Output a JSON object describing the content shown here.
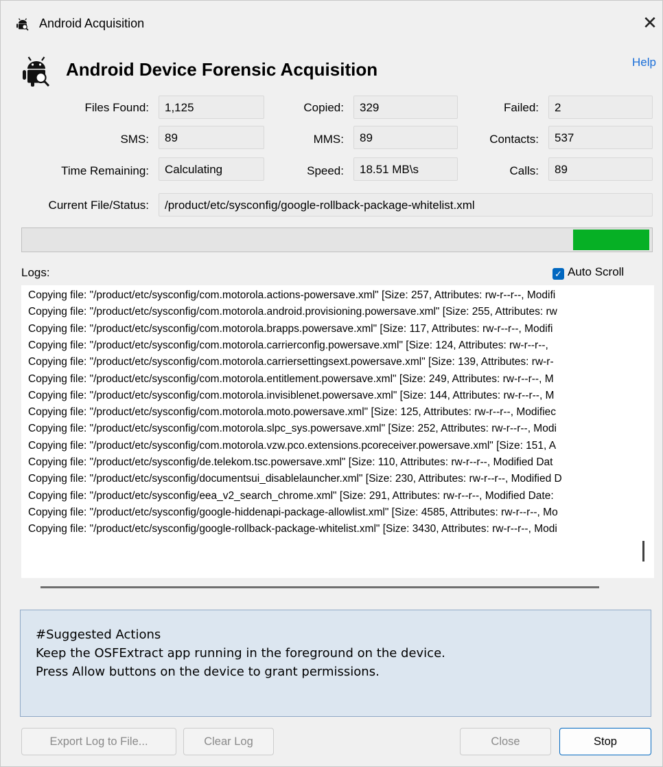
{
  "window": {
    "title": "Android Acquisition",
    "icon": "android-forensics-icon",
    "close_glyph": "✕"
  },
  "header": {
    "title": "Android Device Forensic Acquisition",
    "help": "Help"
  },
  "stats": {
    "files_found": {
      "label": "Files Found:",
      "value": "1,125"
    },
    "copied": {
      "label": "Copied:",
      "value": "329"
    },
    "failed": {
      "label": "Failed:",
      "value": "2"
    },
    "sms": {
      "label": "SMS:",
      "value": "89"
    },
    "mms": {
      "label": "MMS:",
      "value": "89"
    },
    "contacts": {
      "label": "Contacts:",
      "value": "537"
    },
    "time_remaining": {
      "label": "Time Remaining:",
      "value": "Calculating"
    },
    "speed": {
      "label": "Speed:",
      "value": "18.51 MB\\s"
    },
    "calls": {
      "label": "Calls:",
      "value": "89"
    },
    "current_file": {
      "label": "Current File/Status:",
      "value": "/product/etc/sysconfig/google-rollback-package-whitelist.xml"
    }
  },
  "progress": {
    "filled_fraction_from": 0.874,
    "filled_fraction_to": 1.0,
    "fill_color": "#06b025"
  },
  "logs": {
    "label": "Logs:",
    "auto_scroll": {
      "label": "Auto Scroll",
      "checked": true
    },
    "lines": [
      "Copying file: \"/product/etc/sysconfig/com.motorola.actions-powersave.xml\" [Size: 257, Attributes: rw-r--r--, Modifi",
      "Copying file: \"/product/etc/sysconfig/com.motorola.android.provisioning.powersave.xml\" [Size: 255, Attributes: rw",
      "Copying file: \"/product/etc/sysconfig/com.motorola.brapps.powersave.xml\" [Size: 117, Attributes: rw-r--r--, Modifi",
      "Copying file: \"/product/etc/sysconfig/com.motorola.carrierconfig.powersave.xml\" [Size: 124, Attributes: rw-r--r--, ",
      "Copying file: \"/product/etc/sysconfig/com.motorola.carriersettingsext.powersave.xml\" [Size: 139, Attributes: rw-r-",
      "Copying file: \"/product/etc/sysconfig/com.motorola.entitlement.powersave.xml\" [Size: 249, Attributes: rw-r--r--, M",
      "Copying file: \"/product/etc/sysconfig/com.motorola.invisiblenet.powersave.xml\" [Size: 144, Attributes: rw-r--r--, M",
      "Copying file: \"/product/etc/sysconfig/com.motorola.moto.powersave.xml\" [Size: 125, Attributes: rw-r--r--, Modifiec",
      "Copying file: \"/product/etc/sysconfig/com.motorola.slpc_sys.powersave.xml\" [Size: 252, Attributes: rw-r--r--, Modi",
      "Copying file: \"/product/etc/sysconfig/com.motorola.vzw.pco.extensions.pcoreceiver.powersave.xml\" [Size: 151, A",
      "Copying file: \"/product/etc/sysconfig/de.telekom.tsc.powersave.xml\" [Size: 110, Attributes: rw-r--r--, Modified Dat",
      "Copying file: \"/product/etc/sysconfig/documentsui_disablelauncher.xml\" [Size: 230, Attributes: rw-r--r--, Modified D",
      "Copying file: \"/product/etc/sysconfig/eea_v2_search_chrome.xml\" [Size: 291, Attributes: rw-r--r--, Modified Date:",
      "Copying file: \"/product/etc/sysconfig/google-hiddenapi-package-allowlist.xml\" [Size: 4585, Attributes: rw-r--r--, Mo",
      "Copying file: \"/product/etc/sysconfig/google-rollback-package-whitelist.xml\" [Size: 3430, Attributes: rw-r--r--, Modi"
    ]
  },
  "suggested": {
    "heading": "#Suggested Actions",
    "line1": "Keep the OSFExtract app running in the foreground on the device.",
    "line2": "Press Allow buttons on the device to grant permissions."
  },
  "buttons": {
    "export": "Export Log to File...",
    "clear": "Clear Log",
    "close": "Close",
    "stop": "Stop"
  }
}
